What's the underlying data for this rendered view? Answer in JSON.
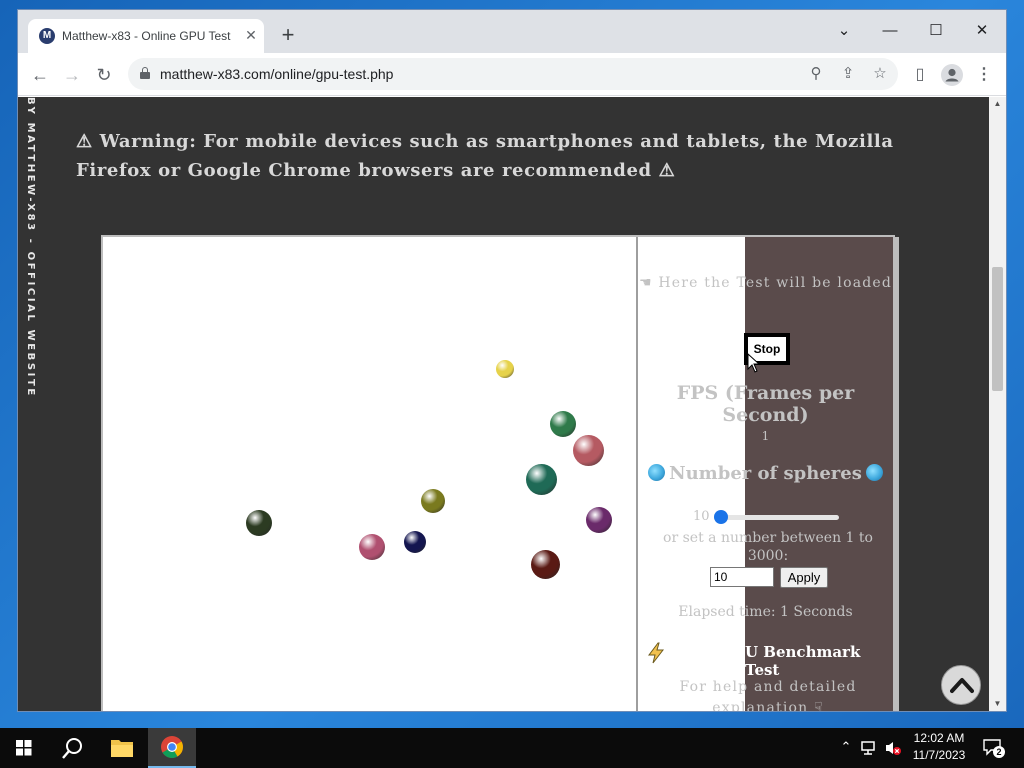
{
  "browser": {
    "tab_title": "Matthew-x83 - Online GPU Test",
    "tab_favicon": "M",
    "url": "matthew-x83.com/online/gpu-test.php"
  },
  "page": {
    "vertical_brand": "BY MATTHEW-X83 - OFFICIAL WEBSITE",
    "warning": "⚠ Warning: For mobile devices such as smartphones and tablets, the Mozilla Firefox or Google Chrome browsers are recommended ⚠"
  },
  "test": {
    "loaded_message": "☚ Here the Test will be loaded",
    "stop_label": "Stop",
    "fps_title": "FPS (Frames per Second)",
    "fps_value": "1",
    "spheres_title": "Number of spheres",
    "slider_min": "10",
    "slider_value": 10,
    "slider_max": 3000,
    "range_hint": "or set a number between 1 to 3000:",
    "input_value": "10",
    "apply_label": "Apply",
    "elapsed": "Elapsed time: 1 Seconds",
    "benchmark_title": "U Benchmark Test",
    "help_text": "For help and detailed explanation ☟",
    "spheres": [
      {
        "name": "sphere-1",
        "color": "#e6d24a"
      },
      {
        "name": "sphere-2",
        "color": "#2f7a4a"
      },
      {
        "name": "sphere-3",
        "color": "#b55a62"
      },
      {
        "name": "sphere-4",
        "color": "#1f6a56"
      },
      {
        "name": "sphere-5",
        "color": "#7a7a1e"
      },
      {
        "name": "sphere-6",
        "color": "#6a2a6a"
      },
      {
        "name": "sphere-7",
        "color": "#2c3b22"
      },
      {
        "name": "sphere-8",
        "color": "#b05070"
      },
      {
        "name": "sphere-9",
        "color": "#141650"
      },
      {
        "name": "sphere-10",
        "color": "#5a1a14"
      }
    ]
  },
  "taskbar": {
    "time": "12:02 AM",
    "date": "11/7/2023",
    "notification_count": "2"
  }
}
